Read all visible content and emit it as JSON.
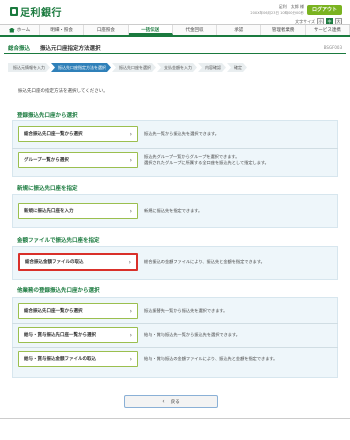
{
  "header": {
    "bank_name": "足利銀行",
    "user_line1": "足利　太郎 様",
    "user_line2": "20XX年06月23日 10時00分00秒",
    "logout_label": "ログアウト",
    "fontsize_label": "文字サイズ",
    "fontsize_options": [
      "小",
      "中",
      "大"
    ]
  },
  "nav": {
    "items": [
      "ホーム",
      "明細・照会",
      "口座照会",
      "一括伝送",
      "代金回収",
      "承認",
      "管理者業務",
      "サービス連携"
    ]
  },
  "page": {
    "title_main": "総合振込",
    "title_sub": "振込元口座指定方法選択",
    "code": "BSGF003"
  },
  "steps": [
    "振込元情報を入力",
    "振込先口座指定方法を選択",
    "振込先口座を選択",
    "支払金額を入力",
    "内容確認",
    "確定"
  ],
  "intro": "振込先口座の指定方法を選択してください。",
  "sections": [
    {
      "title": "登録振込先口座から選択",
      "options": [
        {
          "label": "総合振込先口座一覧から選択",
          "desc": "振込先一覧から振込先を選択できます。"
        },
        {
          "label": "グループ一覧から選択",
          "desc": "振込先グループ一覧からグループを選択できます。\n選択されたグループに所属する全口座を振込先として指定します。"
        }
      ]
    },
    {
      "title": "新規に振込先口座を指定",
      "options": [
        {
          "label": "新規に振込先口座を入力",
          "desc": "新規に振込先を指定できます。"
        }
      ]
    },
    {
      "title": "金額ファイルで振込先口座を指定",
      "options": [
        {
          "label": "総合振込金額ファイルの取込",
          "desc": "総合振込の金額ファイルにより、振込先と金額を指定できます。"
        }
      ]
    },
    {
      "title": "他業務の登録振込先口座から選択",
      "options": [
        {
          "label": "総合振込先口座一覧から選択",
          "desc": "振込振替先一覧から振込先を選択できます。"
        },
        {
          "label": "給与・賞与振込先口座一覧から選択",
          "desc": "給与・賞与振込先一覧から振込先を選択できます。"
        },
        {
          "label": "給与・賞与振込金額ファイルの取込",
          "desc": "給与・賞与振込の金額ファイルにより、振込先と金額を指定できます。"
        }
      ]
    }
  ],
  "back_label": "戻る",
  "colors": {
    "brand": "#1a7a3e",
    "step_active": "#2f80b9",
    "highlight": "#d9302a"
  }
}
